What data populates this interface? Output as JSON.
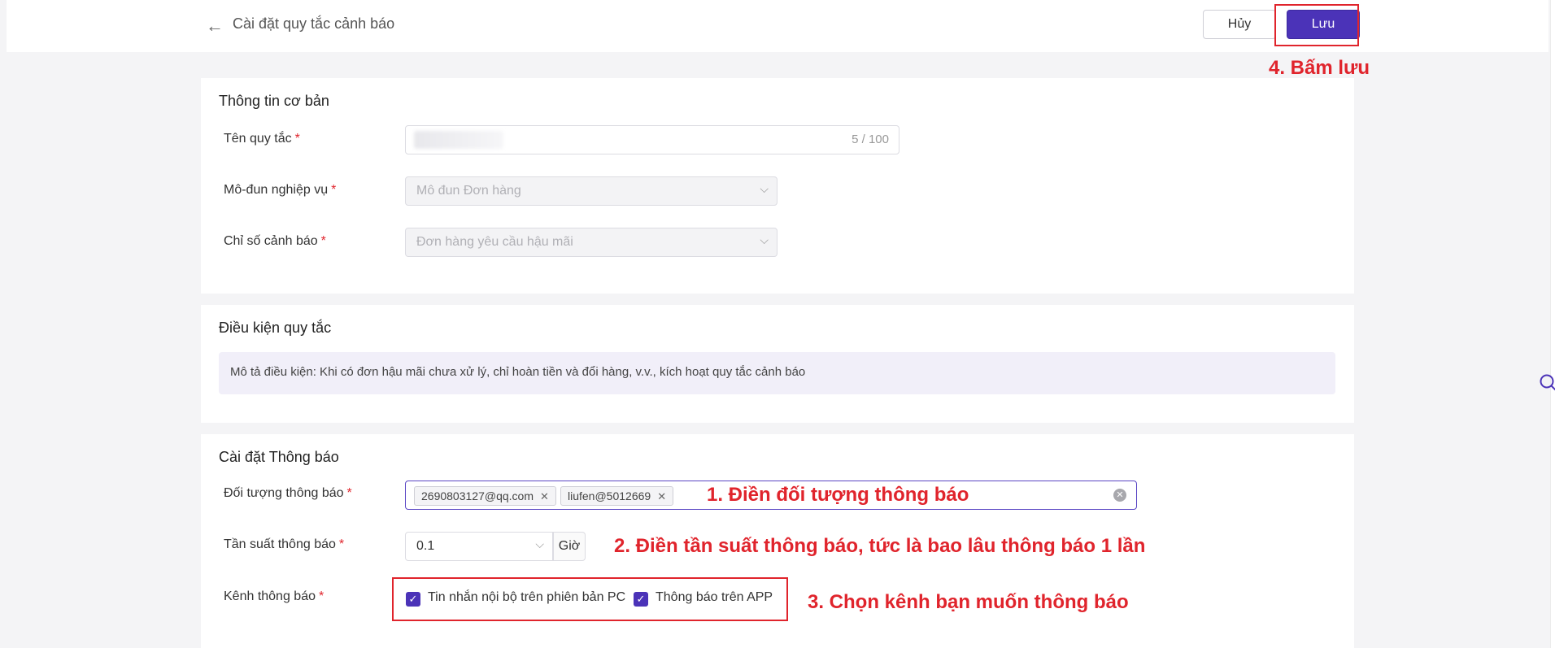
{
  "header": {
    "title": "Cài đặt quy tắc cảnh báo",
    "cancel_label": "Hủy",
    "save_label": "Lưu",
    "back_icon": "arrow-left-icon"
  },
  "basic": {
    "title": "Thông tin cơ bản",
    "rule_name_label": "Tên quy tắc",
    "rule_name_count": "5 / 100",
    "module_label": "Mô-đun nghiệp vụ",
    "module_value": "Mô đun Đơn hàng",
    "metric_label": "Chỉ số cảnh báo",
    "metric_value": "Đơn hàng yêu cầu hậu mãi"
  },
  "conditions": {
    "title": "Điều kiện quy tắc",
    "description": "Mô tả điều kiện: Khi có đơn hậu mãi chưa xử lý, chỉ hoàn tiền và đổi hàng, v.v., kích hoạt quy tắc cảnh báo"
  },
  "notify": {
    "title": "Cài đặt Thông báo",
    "target_label": "Đối tượng thông báo",
    "targets": [
      "2690803127@qq.com",
      "liufen@5012669"
    ],
    "frequency_label": "Tần suất thông báo",
    "frequency_value": "0.1",
    "frequency_unit": "Giờ",
    "channel_label": "Kênh thông báo",
    "channels": [
      "Tin nhắn nội bộ trên phiên bản PC",
      "Thông báo trên APP"
    ]
  },
  "annotations": {
    "a1": "1. Điền đối tượng thông báo",
    "a2": "2. Điền tần suất thông báo, tức là bao lâu thông báo 1 lần",
    "a3": "3. Chọn kênh bạn muốn thông báo",
    "a4": "4. Bấm lưu"
  },
  "colors": {
    "accent": "#4b33b8",
    "annotation": "#e0242c"
  }
}
